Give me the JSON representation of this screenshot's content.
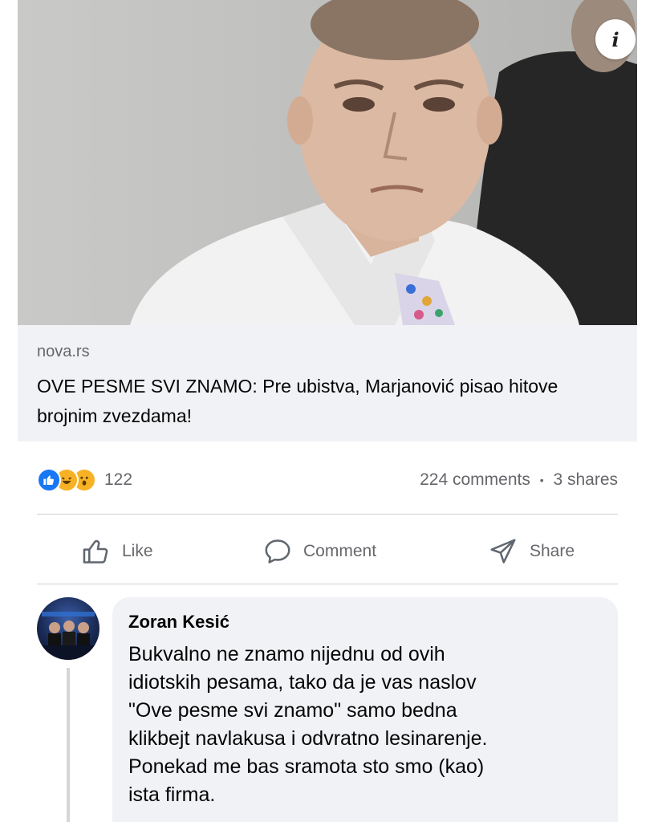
{
  "post": {
    "link_preview": {
      "image_alt": "",
      "info_icon": "info-icon",
      "domain": "nova.rs",
      "title": "OVE PESME SVI ZNAMO: Pre ubistva, Marjanović pisao hitove brojnim zvezdama!"
    },
    "reactions": {
      "icons": [
        "like-reaction-icon",
        "haha-reaction-icon",
        "wow-reaction-icon"
      ],
      "count": "122"
    },
    "engagement": {
      "comments": "224 comments",
      "separator": "•",
      "shares": "3 shares"
    },
    "actions": {
      "like": "Like",
      "comment": "Comment",
      "share": "Share"
    }
  },
  "comment": {
    "author": "Zoran Kesić",
    "text": "Bukvalno ne znamo nijednu od ovih\nidiotskih pesama, tako da je vas naslov\n\"Ove pesme svi znamo\" samo bedna\nklikbejt navlakusa i odvratno lesinarenje.\nPonekad me bas sramota sto smo (kao)\nista firma."
  },
  "colors": {
    "facebook_blue": "#1877f2",
    "secondary_text": "#65676b",
    "bubble_bg": "#f0f2f5"
  }
}
